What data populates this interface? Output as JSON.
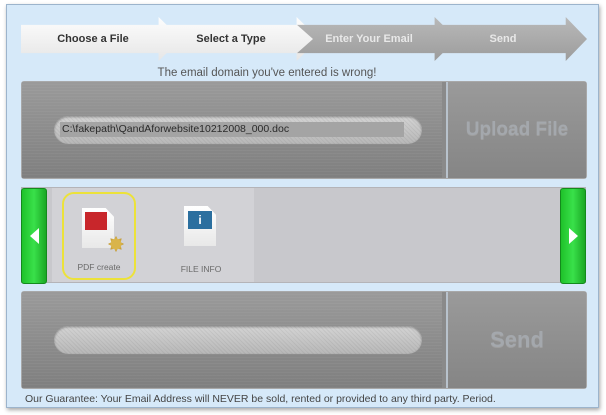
{
  "steps": [
    {
      "label": "Choose a File",
      "state": "active"
    },
    {
      "label": "Select a Type",
      "state": "active"
    },
    {
      "label": "Enter Your Email",
      "state": "inactive"
    },
    {
      "label": "Send",
      "state": "inactive"
    }
  ],
  "error_message": "The email domain you've entered is wrong!",
  "upload": {
    "file_path": "C:\\fakepath\\QandAforwebsite10212008_000.doc",
    "button_label": "Upload File"
  },
  "types": [
    {
      "label": "PDF create",
      "icon": "pdf-icon",
      "selected": true
    },
    {
      "label": "FILE INFO",
      "icon": "info-icon",
      "selected": false
    }
  ],
  "send": {
    "email_value": "",
    "button_label": "Send"
  },
  "guarantee": "Our Guarantee: Your Email Address will NEVER be sold, rented or provided to any third party. Period.",
  "colors": {
    "background": "#d6e9f9",
    "arrow_green": "#1fc22a",
    "selection_yellow": "#ece23a",
    "panel_gray": "#8a8a8a"
  }
}
